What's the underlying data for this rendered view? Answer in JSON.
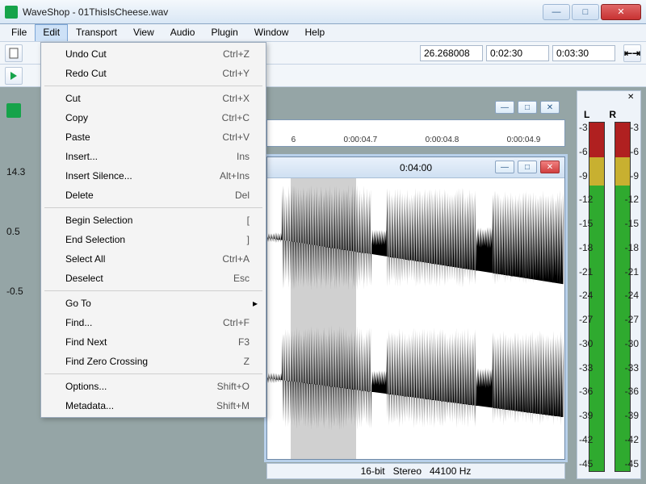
{
  "window": {
    "title": "WaveShop - 01ThisIsCheese.wav"
  },
  "menubar": [
    "File",
    "Edit",
    "Transport",
    "View",
    "Audio",
    "Plugin",
    "Window",
    "Help"
  ],
  "open_menu_index": 1,
  "toolbar": {
    "time1": "26.268008",
    "time2": "0:02:30",
    "time3": "0:03:30"
  },
  "edit_menu": {
    "groups": [
      [
        {
          "label": "Undo Cut",
          "shortcut": "Ctrl+Z"
        },
        {
          "label": "Redo Cut",
          "shortcut": "Ctrl+Y"
        }
      ],
      [
        {
          "label": "Cut",
          "shortcut": "Ctrl+X"
        },
        {
          "label": "Copy",
          "shortcut": "Ctrl+C"
        },
        {
          "label": "Paste",
          "shortcut": "Ctrl+V"
        },
        {
          "label": "Insert...",
          "shortcut": "Ins"
        },
        {
          "label": "Insert Silence...",
          "shortcut": "Alt+Ins"
        },
        {
          "label": "Delete",
          "shortcut": "Del"
        }
      ],
      [
        {
          "label": "Begin Selection",
          "shortcut": "["
        },
        {
          "label": "End Selection",
          "shortcut": "]"
        },
        {
          "label": "Select All",
          "shortcut": "Ctrl+A"
        },
        {
          "label": "Deselect",
          "shortcut": "Esc"
        }
      ],
      [
        {
          "label": "Go To",
          "shortcut": "",
          "submenu": true
        },
        {
          "label": "Find...",
          "shortcut": "Ctrl+F"
        },
        {
          "label": "Find Next",
          "shortcut": "F3"
        },
        {
          "label": "Find Zero Crossing",
          "shortcut": "Z"
        }
      ],
      [
        {
          "label": "Options...",
          "shortcut": "Shift+O"
        },
        {
          "label": "Metadata...",
          "shortcut": "Shift+M"
        }
      ]
    ]
  },
  "left_axis": {
    "val0": "14.3",
    "val1": "0.5",
    "val2": "-0.5"
  },
  "ruler_top": {
    "ticks": [
      "6",
      "0:00:04.7",
      "0:00:04.8",
      "0:00:04.9"
    ]
  },
  "wave_window": {
    "title_time": "0:04:00"
  },
  "status": {
    "bits": "16-bit",
    "mode": "Stereo",
    "rate": "44100 Hz"
  },
  "meters": {
    "L": "L",
    "R": "R",
    "ticks": [
      "-3",
      "-6",
      "-9",
      "-12",
      "-15",
      "-18",
      "-21",
      "-24",
      "-27",
      "-30",
      "-33",
      "-36",
      "-39",
      "-42",
      "-45"
    ]
  }
}
